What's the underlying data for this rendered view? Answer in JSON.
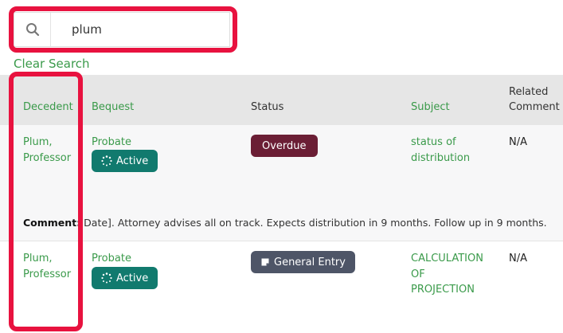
{
  "search": {
    "value": "plum",
    "clear_label": "Clear Search"
  },
  "table": {
    "headers": {
      "decedent": "Decedent",
      "bequest": "Bequest",
      "status": "Status",
      "subject": "Subject",
      "related_comment_line1": "Related",
      "related_comment_line2": "Comment"
    },
    "rows": [
      {
        "decedent_line1": "Plum,",
        "decedent_line2": "Professor",
        "bequest": "Probate",
        "bequest_badge": "Active",
        "status": "Overdue",
        "subject_line1": "status of",
        "subject_line2": "distribution",
        "related_comment": "N/A",
        "comment_label": "Comment:",
        "comment_text": "Date]. Attorney advises all on track. Expects distribution in 9 months. Follow up in 9 months."
      },
      {
        "decedent_line1": "Plum,",
        "decedent_line2": "Professor",
        "bequest": "Probate",
        "bequest_badge": "Active",
        "status": "General Entry",
        "subject_line1": "CALCULATION",
        "subject_line2": "OF",
        "subject_line3": "PROJECTION",
        "related_comment": "N/A"
      }
    ]
  },
  "colors": {
    "accent_green": "#3a9a4a",
    "active_badge": "#117a6e",
    "overdue_badge": "#6b1e35",
    "general_badge": "#4e5567",
    "highlight": "#e8123f"
  }
}
